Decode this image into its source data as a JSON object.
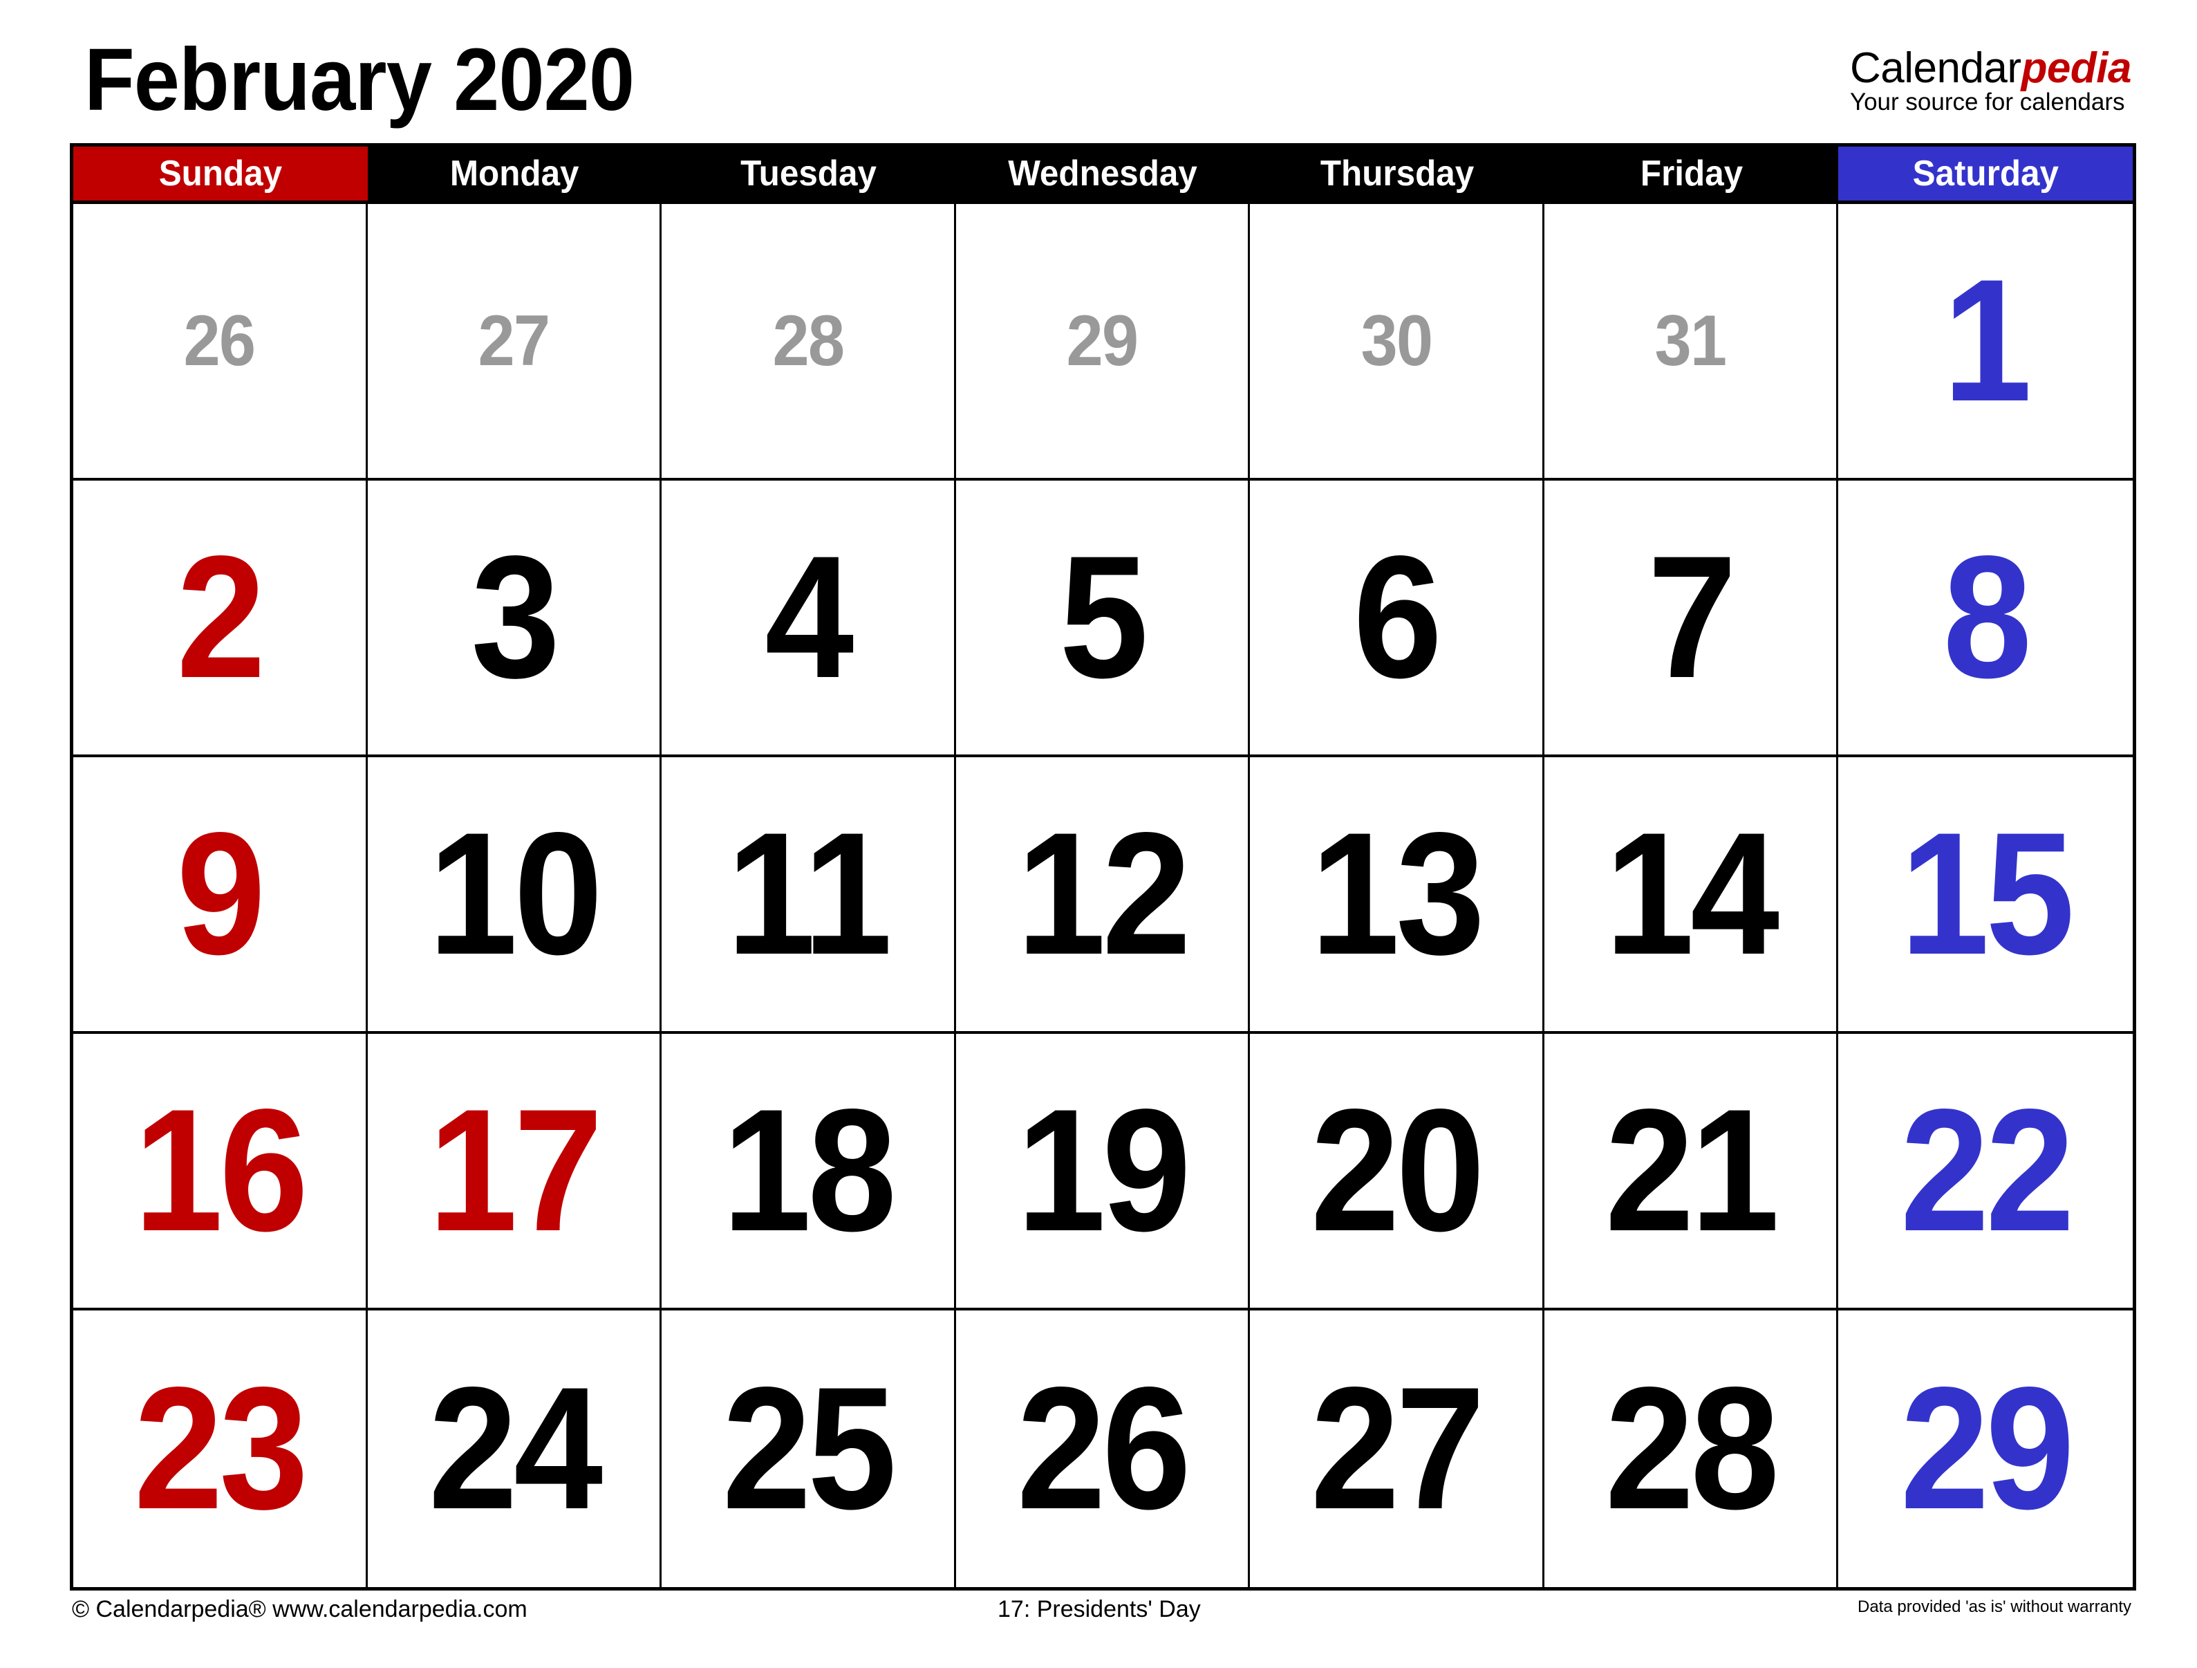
{
  "title": "February 2020",
  "brand": {
    "name_plain": "Calendar",
    "name_accent": "pedia",
    "tagline": "Your source for calendars"
  },
  "colors": {
    "sunday": "#c00000",
    "saturday": "#3333cc",
    "weekday": "#000000",
    "other_month": "#999999",
    "holiday": "#c00000"
  },
  "weekdays": [
    {
      "label": "Sunday",
      "bg": "#c00000"
    },
    {
      "label": "Monday",
      "bg": "#000000"
    },
    {
      "label": "Tuesday",
      "bg": "#000000"
    },
    {
      "label": "Wednesday",
      "bg": "#000000"
    },
    {
      "label": "Thursday",
      "bg": "#000000"
    },
    {
      "label": "Friday",
      "bg": "#000000"
    },
    {
      "label": "Saturday",
      "bg": "#3333cc"
    }
  ],
  "weeks": [
    [
      {
        "day": "26",
        "type": "other"
      },
      {
        "day": "27",
        "type": "other"
      },
      {
        "day": "28",
        "type": "other"
      },
      {
        "day": "29",
        "type": "other"
      },
      {
        "day": "30",
        "type": "other"
      },
      {
        "day": "31",
        "type": "other"
      },
      {
        "day": "1",
        "type": "saturday"
      }
    ],
    [
      {
        "day": "2",
        "type": "sunday"
      },
      {
        "day": "3",
        "type": "weekday"
      },
      {
        "day": "4",
        "type": "weekday"
      },
      {
        "day": "5",
        "type": "weekday"
      },
      {
        "day": "6",
        "type": "weekday"
      },
      {
        "day": "7",
        "type": "weekday"
      },
      {
        "day": "8",
        "type": "saturday"
      }
    ],
    [
      {
        "day": "9",
        "type": "sunday"
      },
      {
        "day": "10",
        "type": "weekday"
      },
      {
        "day": "11",
        "type": "weekday"
      },
      {
        "day": "12",
        "type": "weekday"
      },
      {
        "day": "13",
        "type": "weekday"
      },
      {
        "day": "14",
        "type": "weekday"
      },
      {
        "day": "15",
        "type": "saturday"
      }
    ],
    [
      {
        "day": "16",
        "type": "sunday"
      },
      {
        "day": "17",
        "type": "holiday"
      },
      {
        "day": "18",
        "type": "weekday"
      },
      {
        "day": "19",
        "type": "weekday"
      },
      {
        "day": "20",
        "type": "weekday"
      },
      {
        "day": "21",
        "type": "weekday"
      },
      {
        "day": "22",
        "type": "saturday"
      }
    ],
    [
      {
        "day": "23",
        "type": "sunday"
      },
      {
        "day": "24",
        "type": "weekday"
      },
      {
        "day": "25",
        "type": "weekday"
      },
      {
        "day": "26",
        "type": "weekday"
      },
      {
        "day": "27",
        "type": "weekday"
      },
      {
        "day": "28",
        "type": "weekday"
      },
      {
        "day": "29",
        "type": "saturday"
      }
    ]
  ],
  "footer": {
    "copyright": "© Calendarpedia®   www.calendarpedia.com",
    "holidays": "17: Presidents' Day",
    "disclaimer": "Data provided 'as is' without warranty"
  }
}
